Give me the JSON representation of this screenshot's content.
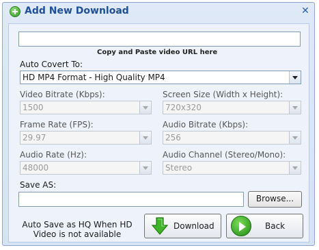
{
  "window": {
    "title": "Add New Download",
    "close_glyph": "✕"
  },
  "url_input": {
    "value": "",
    "hint": "Copy and Paste video URL here"
  },
  "auto_convert": {
    "label": "Auto Covert To:",
    "value": "HD MP4 Format - High Quality MP4"
  },
  "video_bitrate": {
    "label": "Video Bitrate (Kbps):",
    "value": "1500"
  },
  "screen_size": {
    "label": "Screen Size (Width x Height):",
    "value": "720x320"
  },
  "frame_rate": {
    "label": "Frame Rate (FPS):",
    "value": "29.97"
  },
  "audio_bitrate": {
    "label": "Audio Bitrate (Kbps):",
    "value": "256"
  },
  "audio_rate": {
    "label": "Audio Rate (Hz):",
    "value": "48000"
  },
  "audio_channel": {
    "label": "Audio Channel (Stereo/Mono):",
    "value": "Stereo"
  },
  "save_as": {
    "label": "Save AS:",
    "value": "",
    "browse_label": "Browse..."
  },
  "note": {
    "line1": "Auto Save as HQ When HD",
    "line2": "Video is not available"
  },
  "buttons": {
    "download_label": "Download",
    "back_label": "Back"
  },
  "icons": {
    "title": "add-circle-icon",
    "download": "download-arrow-icon",
    "back": "play-back-icon"
  },
  "colors": {
    "title_text": "#1e4f99",
    "accent_green": "#2f9a1f",
    "dialog_bg": "#dfe9f7"
  }
}
